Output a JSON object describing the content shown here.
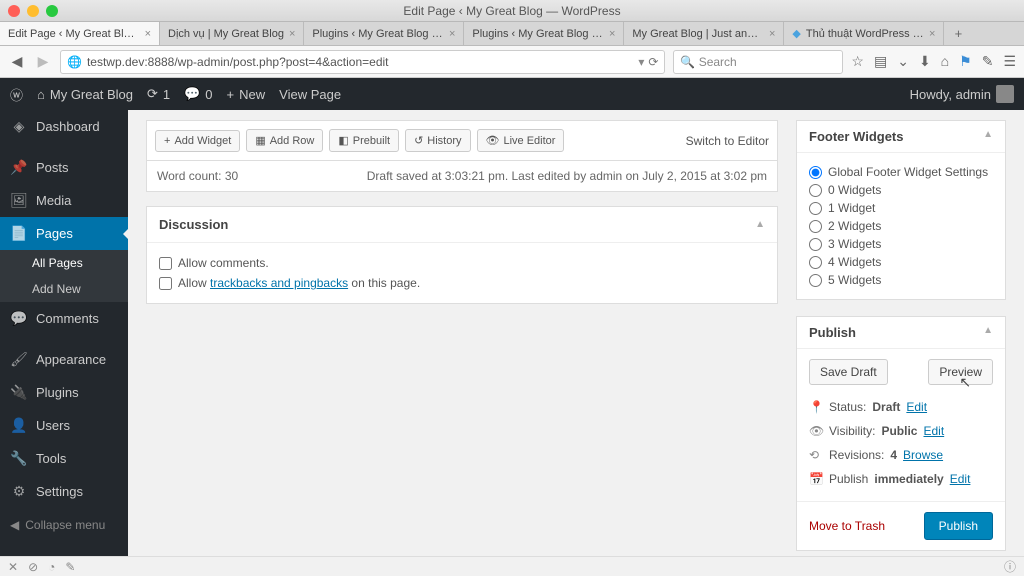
{
  "window": {
    "title": "Edit Page ‹ My Great Blog — WordPress"
  },
  "browser_tabs": [
    {
      "label": "Edit Page ‹ My Great Blog — …",
      "active": true
    },
    {
      "label": "Dịch vụ | My Great Blog",
      "active": false
    },
    {
      "label": "Plugins ‹ My Great Blog — Wo…",
      "active": false
    },
    {
      "label": "Plugins ‹ My Great Blog — Wo…",
      "active": false
    },
    {
      "label": "My Great Blog | Just another …",
      "active": false
    },
    {
      "label": "Thủ thuật WordPress - SE…",
      "active": false
    }
  ],
  "url": "testwp.dev:8888/wp-admin/post.php?post=4&action=edit",
  "search_placeholder": "Search",
  "adminbar": {
    "site": "My Great Blog",
    "updates": "1",
    "comments": "0",
    "new": "New",
    "view": "View Page",
    "howdy": "Howdy, admin"
  },
  "sidebar": {
    "items": [
      {
        "icon": "⏱",
        "label": "Dashboard"
      },
      {
        "icon": "📌",
        "label": "Posts"
      },
      {
        "icon": "🖼",
        "label": "Media"
      },
      {
        "icon": "📄",
        "label": "Pages",
        "current": true,
        "sub": [
          "All Pages",
          "Add New"
        ]
      },
      {
        "icon": "💬",
        "label": "Comments"
      },
      {
        "icon": "🖌",
        "label": "Appearance"
      },
      {
        "icon": "🔌",
        "label": "Plugins"
      },
      {
        "icon": "👤",
        "label": "Users"
      },
      {
        "icon": "🔧",
        "label": "Tools"
      },
      {
        "icon": "⚙",
        "label": "Settings"
      }
    ],
    "collapse": "Collapse menu"
  },
  "editor_toolbar": {
    "add_widget": "Add Widget",
    "add_row": "Add Row",
    "prebuilt": "Prebuilt",
    "history": "History",
    "live": "Live Editor",
    "switch": "Switch to Editor"
  },
  "status": {
    "wordcount_label": "Word count:",
    "wordcount": "30",
    "saved": "Draft saved at 3:03:21 pm. Last edited by admin on July 2, 2015 at 3:02 pm"
  },
  "discussion": {
    "title": "Discussion",
    "allow_comments": "Allow comments.",
    "allow_pre": "Allow ",
    "trackbacks": "trackbacks and pingbacks",
    "allow_post": " on this page."
  },
  "footer_widgets": {
    "title": "Footer Widgets",
    "options": [
      "Global Footer Widget Settings",
      "0 Widgets",
      "1 Widget",
      "2 Widgets",
      "3 Widgets",
      "4 Widgets",
      "5 Widgets"
    ],
    "selected": 0
  },
  "publish": {
    "title": "Publish",
    "save_draft": "Save Draft",
    "preview": "Preview",
    "status_label": "Status:",
    "status_value": "Draft",
    "status_edit": "Edit",
    "visibility_label": "Visibility:",
    "visibility_value": "Public",
    "visibility_edit": "Edit",
    "revisions_label": "Revisions:",
    "revisions_value": "4",
    "revisions_browse": "Browse",
    "schedule_label": "Publish",
    "schedule_value": "immediately",
    "schedule_edit": "Edit",
    "trash": "Move to Trash",
    "publish_btn": "Publish"
  }
}
